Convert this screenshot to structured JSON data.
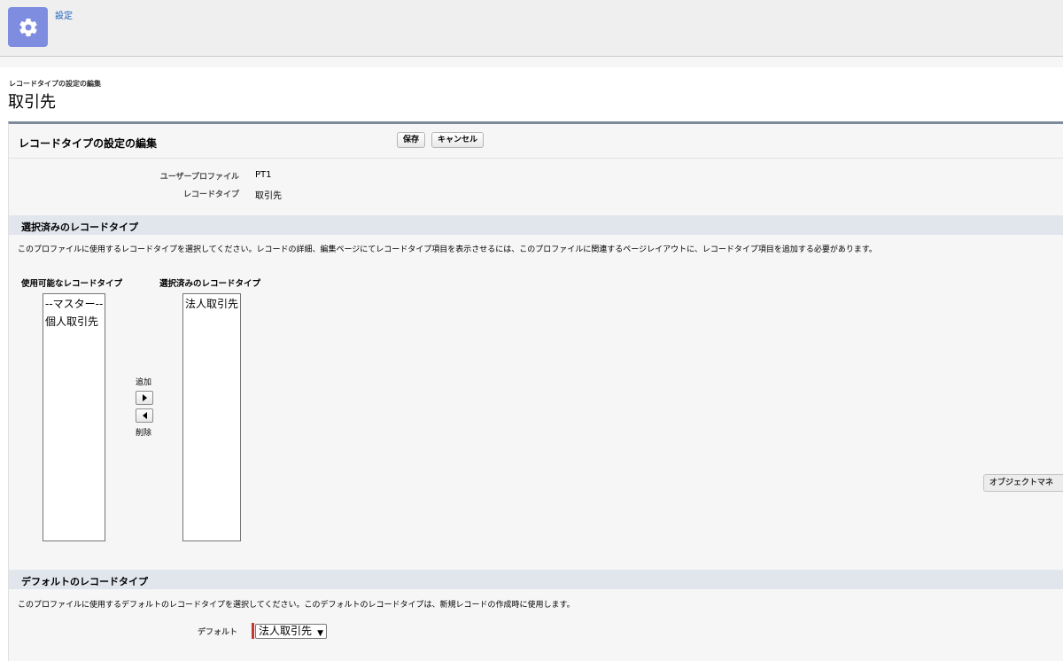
{
  "header": {
    "app_icon": "gear-icon",
    "breadcrumb": "設定"
  },
  "page": {
    "subtitle": "レコードタイプの設定の編集",
    "title": "取引先"
  },
  "panel": {
    "title": "レコードタイプの設定の編集",
    "save_label": "保存",
    "cancel_label": "キャンセル",
    "info": {
      "profile_label": "ユーザープロファイル",
      "profile_value": "PT1",
      "record_type_label": "レコードタイプ",
      "record_type_value": "取引先"
    }
  },
  "selected_section": {
    "title": "選択済みのレコードタイプ",
    "description": "このプロファイルに使用するレコードタイプを選択してください。レコードの詳細、編集ページにてレコードタイプ項目を表示させるには、このプロファイルに関連するページレイアウトに、レコードタイプ項目を追加する必要があります。",
    "available_label": "使用可能なレコードタイプ",
    "available_options": [
      "--マスター--",
      "個人取引先"
    ],
    "selected_label": "選択済みのレコードタイプ",
    "selected_options": [
      "法人取引先"
    ],
    "add_label": "追加",
    "remove_label": "削除"
  },
  "default_section": {
    "title": "デフォルトのレコードタイプ",
    "description": "このプロファイルに使用するデフォルトのレコードタイプを選択してください。このデフォルトのレコードタイプは、新規レコードの作成時に使用します。",
    "default_label": "デフォルト",
    "default_value": "法人取引先",
    "side_button": "オブジェクトマネ"
  },
  "colors": {
    "accent": "#7f8de1",
    "link": "#1b5fbe",
    "required": "#c23934",
    "section_bar": "#e1e5ec"
  }
}
